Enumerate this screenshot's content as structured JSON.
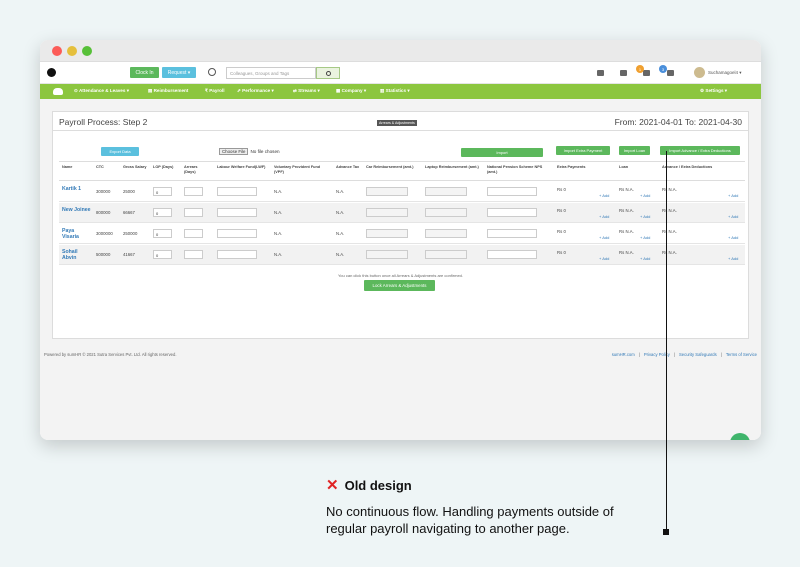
{
  "topbar": {
    "clock_in": "Clock In",
    "request": "Request ▾",
    "search_placeholder": "Colleagues, Groups and Tags",
    "badge_1": "1",
    "badge_2": "3",
    "username": "Suchamagoel4 ▾"
  },
  "nav": {
    "items": [
      "⊙ Attendance & Leaves ▾",
      "▤ Reimbursement",
      "₹ Payroll",
      "⇗ Performance ▾",
      "⇄ Streams ▾",
      "▦ Company ▾",
      "▥ Statistics ▾"
    ],
    "settings": "⚙ Settings ▾"
  },
  "panel": {
    "title": "Payroll Process: Step 2",
    "arrears_tab": "Arrears & Adjustments",
    "date_range": "From: 2021-04-01 To: 2021-04-30",
    "export_label": "Export Data",
    "choose_file": "Choose File",
    "no_file": "No file chosen",
    "import_label": "Import",
    "import_extra": "Import Extra Payment",
    "import_loan": "Import Loan",
    "import_adv": "Import Advance / Extra Deductions",
    "note": "You can click this button once all Arrears & Adjustments are confirmed.",
    "lock_label": "Lock Arrears & Adjustments"
  },
  "table": {
    "headers": [
      "Name",
      "CTC",
      "Gross Salary",
      "LOP (Days)",
      "Arrears (Days)",
      "Labour Welfare Fund(LWF)",
      "Voluntary Provident Fund (VPF)",
      "Advance Tax",
      "Car Reimbursement (amt.)",
      "Laptop Reimbursement (amt.)",
      "National Pension Scheme NPS (amt.)",
      "Extra Payments",
      "Loan",
      "Advance / Extra Deductions"
    ],
    "rows": [
      {
        "name": "Kartik 1",
        "ctc": "300000",
        "gross": "25000",
        "lop": "0",
        "vpf": "N.A.",
        "tax": "N.A.",
        "extra": "Rs 0",
        "loan": "Rs N.A.",
        "adv": "Rs N.A.",
        "add": "+ Add"
      },
      {
        "name": "New Joinee",
        "ctc": "800000",
        "gross": "66667",
        "lop": "0",
        "vpf": "N.A.",
        "tax": "N.A.",
        "extra": "Rs 0",
        "loan": "Rs N.A.",
        "adv": "Rs N.A.",
        "add": "+ Add"
      },
      {
        "name": "Paya Visaria",
        "ctc": "3000000",
        "gross": "250000",
        "lop": "0",
        "vpf": "N.A.",
        "tax": "N.A.",
        "extra": "Rs 0",
        "loan": "Rs N.A.",
        "adv": "Rs N.A.",
        "add": "+ Add"
      },
      {
        "name": "Sohail Abvin",
        "ctc": "500000",
        "gross": "41667",
        "lop": "0",
        "vpf": "N.A.",
        "tax": "N.A.",
        "extra": "Rs 0",
        "loan": "Rs N.A.",
        "adv": "Rs N.A.",
        "add": "+ Add"
      }
    ]
  },
  "footer": {
    "powered": "Powered by sumHR © 2021 Sutra Services Pvt. Ltd. All rights reserved.",
    "links": [
      "sumHR.com",
      "Privacy Policy",
      "Security Safeguards",
      "Terms of Service"
    ],
    "sep": "|"
  },
  "annotation": {
    "heading": "Old design",
    "body": "No continuous flow. Handling payments outside of regular payroll navigating to another page."
  }
}
